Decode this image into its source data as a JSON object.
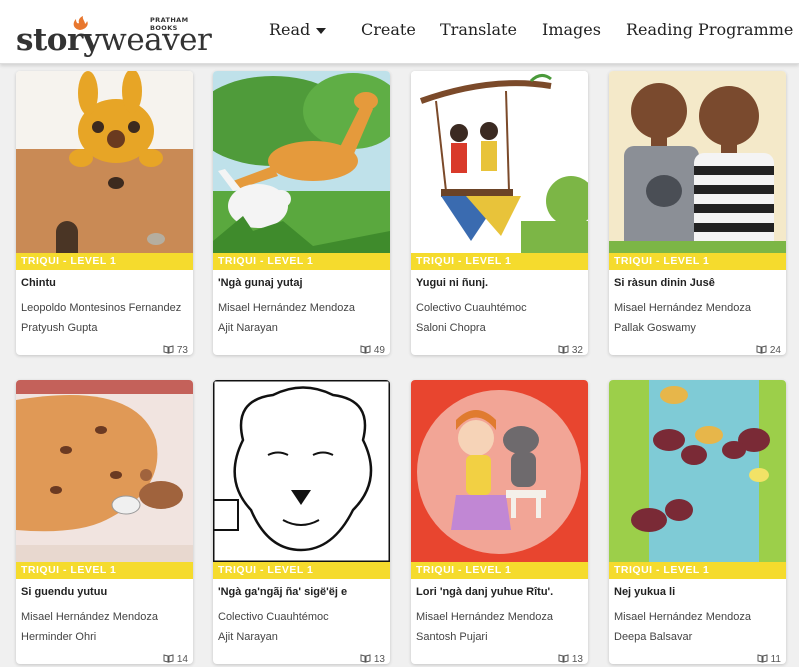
{
  "header": {
    "logo_text_story": "story",
    "logo_text_weaver": "weaver",
    "logo_publisher": "PRATHAM BOOKS",
    "nav": [
      "Read",
      "Create",
      "Translate",
      "Images",
      "Reading Programme"
    ]
  },
  "cards": [
    {
      "level": "TRIQUI - LEVEL 1",
      "title": "Chintu",
      "author": "Leopoldo Montesinos Fernandez",
      "illustrator": "Pratyush Gupta",
      "reads": "73"
    },
    {
      "level": "TRIQUI - LEVEL 1",
      "title": "'Ngà gunaj yutaj",
      "author": "Misael Hernández Mendoza",
      "illustrator": "Ajit Narayan",
      "reads": "49"
    },
    {
      "level": "TRIQUI - LEVEL 1",
      "title": "Yugui ni ñunj.",
      "author": "Colectivo Cuauhtémoc",
      "illustrator": "Saloni Chopra",
      "reads": "32"
    },
    {
      "level": "TRIQUI - LEVEL 1",
      "title": "Si ràsun dinin Jusê",
      "author": "Misael Hernández Mendoza",
      "illustrator": "Pallak Goswamy",
      "reads": "24"
    },
    {
      "level": "TRIQUI - LEVEL 1",
      "title": "Si guendu yutuu",
      "author": "Misael Hernández Mendoza",
      "illustrator": "Herminder Ohri",
      "reads": "14"
    },
    {
      "level": "TRIQUI - LEVEL 1",
      "title": "'Ngà ga'ngãj ña' sigë'ëj e",
      "author": "Colectivo Cuauhtémoc",
      "illustrator": "Ajit Narayan",
      "reads": "13"
    },
    {
      "level": "TRIQUI - LEVEL 1",
      "title": "Lori 'ngà danj yuhue Rîtu'.",
      "author": "Misael Hernández Mendoza",
      "illustrator": "Santosh Pujari",
      "reads": "13"
    },
    {
      "level": "TRIQUI - LEVEL 1",
      "title": "Nej yukua li",
      "author": "Misael Hernández Mendoza",
      "illustrator": "Deepa Balsavar",
      "reads": "11"
    }
  ],
  "icons": {
    "reads": "book-icon",
    "dropdown": "caret-down-icon"
  },
  "colors": {
    "level_banner": "#f5db2d",
    "accent_orange": "#e8772e"
  }
}
